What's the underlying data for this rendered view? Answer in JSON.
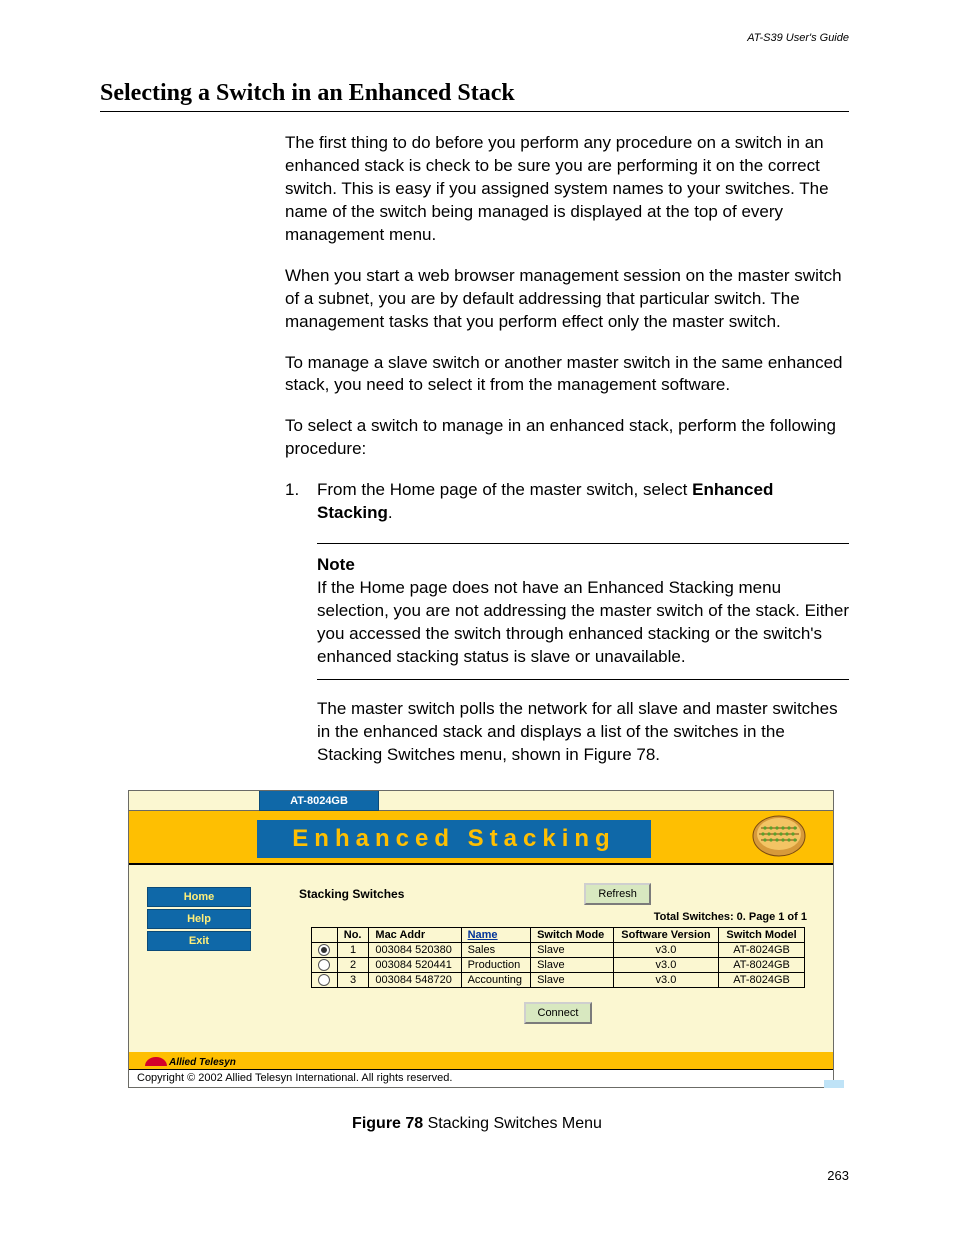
{
  "running_head": "AT-S39 User's Guide",
  "section_title": "Selecting a Switch in an Enhanced Stack",
  "paragraphs": {
    "p1": "The first thing to do before you perform any procedure on a switch in an enhanced stack is check to be sure you are performing it on the correct switch. This is easy if you assigned system names to your switches. The name of the switch being managed is displayed at the top of every management menu.",
    "p2": "When you start a web browser management session on the master switch of a subnet, you are by default addressing that particular switch. The management tasks that you perform effect only the master switch.",
    "p3": "To manage a slave switch or another master switch in the same enhanced stack, you need to select it from the management software.",
    "p4": "To select a switch to manage in an enhanced stack, perform the following procedure:"
  },
  "step1": {
    "num": "1.",
    "pre": "From the Home page of the master switch, select ",
    "bold": "Enhanced Stacking",
    "post": "."
  },
  "note": {
    "head": "Note",
    "body": "If the Home page does not have an Enhanced Stacking menu selection, you are not addressing the master switch of the stack. Either you accessed the switch through enhanced stacking or the switch's enhanced stacking status is slave or unavailable."
  },
  "after_note": "The master switch polls the network for all slave and master switches in the enhanced stack and displays a list of the switches in the Stacking Switches menu, shown in Figure 78.",
  "shot": {
    "top_model": "AT-8024GB",
    "title": "Enhanced Stacking",
    "side": {
      "home": "Home",
      "help": "Help",
      "exit": "Exit"
    },
    "section_label": "Stacking Switches",
    "refresh_btn": "Refresh",
    "totals": "Total Switches: 0. Page 1 of 1",
    "headers": {
      "sel": "",
      "no": "No.",
      "mac": "Mac Addr",
      "name": "Name",
      "mode": "Switch Mode",
      "ver": "Software Version",
      "model": "Switch Model"
    },
    "rows": [
      {
        "sel": true,
        "no": "1",
        "mac": "003084 520380",
        "name": "Sales",
        "mode": "Slave",
        "ver": "v3.0",
        "model": "AT-8024GB"
      },
      {
        "sel": false,
        "no": "2",
        "mac": "003084 520441",
        "name": "Production",
        "mode": "Slave",
        "ver": "v3.0",
        "model": "AT-8024GB"
      },
      {
        "sel": false,
        "no": "3",
        "mac": "003084 548720",
        "name": "Accounting",
        "mode": "Slave",
        "ver": "v3.0",
        "model": "AT-8024GB"
      }
    ],
    "connect_btn": "Connect",
    "brand": "Allied Telesyn",
    "copyright": "Copyright © 2002 Allied Telesyn International. All rights reserved."
  },
  "figure": {
    "label": "Figure 78",
    "caption": "  Stacking Switches Menu"
  },
  "page_number": "263"
}
